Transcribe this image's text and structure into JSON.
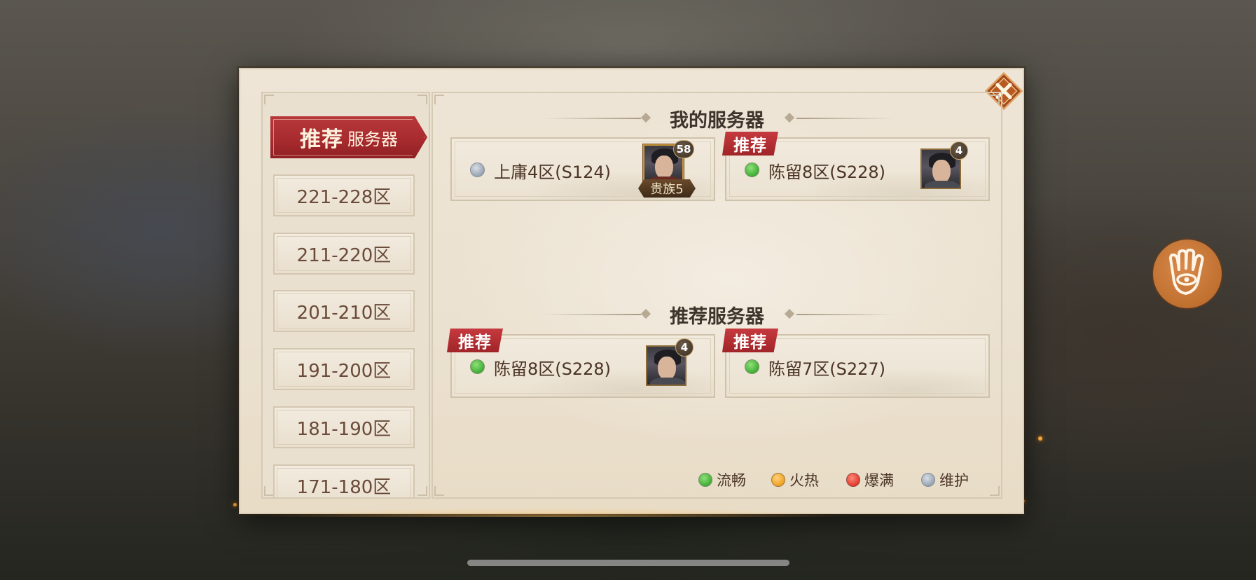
{
  "nav": {
    "active": {
      "big": "推荐",
      "small": "服务器"
    },
    "items": [
      {
        "label": "221-228区"
      },
      {
        "label": "211-220区"
      },
      {
        "label": "201-210区"
      },
      {
        "label": "191-200区"
      },
      {
        "label": "181-190区"
      },
      {
        "label": "171-180区"
      }
    ]
  },
  "my_servers": {
    "title": "我的服务器",
    "cards": [
      {
        "name": "上庸4区(S124)",
        "status": "grey",
        "level": "58",
        "noble": "贵族5",
        "tag": ""
      },
      {
        "name": "陈留8区(S228)",
        "status": "green",
        "level": "4",
        "noble": "",
        "tag": "推荐"
      }
    ]
  },
  "recommended": {
    "title": "推荐服务器",
    "cards": [
      {
        "name": "陈留8区(S228)",
        "status": "green",
        "level": "4",
        "tag": "推荐"
      },
      {
        "name": "陈留7区(S227)",
        "status": "green",
        "level": "",
        "tag": "推荐"
      }
    ]
  },
  "legend": [
    {
      "label": "流畅",
      "color": "#3fae34"
    },
    {
      "label": "火热",
      "color": "#f0a021"
    },
    {
      "label": "爆满",
      "color": "#e03a2e"
    },
    {
      "label": "维护",
      "color": "#97a3b2"
    }
  ],
  "icons": {
    "close": "close-icon",
    "float": "hand-eye-icon"
  }
}
